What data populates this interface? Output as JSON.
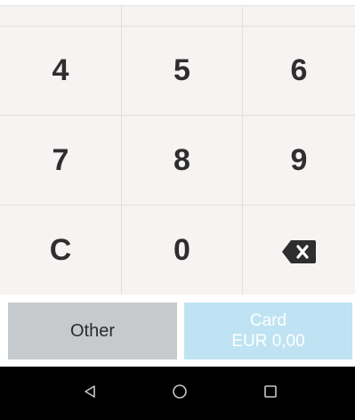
{
  "keypad": {
    "rows": [
      [
        "4",
        "5",
        "6"
      ],
      [
        "7",
        "8",
        "9"
      ],
      [
        "C",
        "0"
      ]
    ],
    "backspace_icon": "backspace-icon"
  },
  "actions": {
    "other_label": "Other",
    "card_label": "Card",
    "card_amount": "EUR 0,00"
  },
  "navbar": {
    "back_icon": "nav-back-icon",
    "home_icon": "nav-home-icon",
    "recents_icon": "nav-recents-icon"
  },
  "colors": {
    "keypad_bg": "#f6f3f2",
    "other_button": "#c7cacd",
    "card_button_disabled": "#bfe3f2",
    "navbar": "#000000"
  }
}
